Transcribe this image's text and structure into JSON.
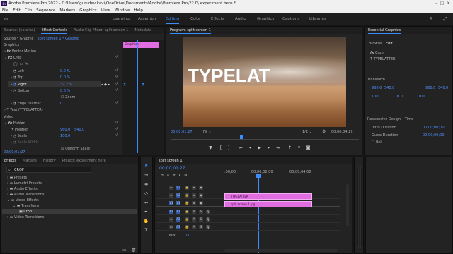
{
  "titlebar": {
    "text": "Adobe Premiere Pro 2022 - C:\\Users\\gurudev kavi\\OneDrive\\Documents\\Adobe\\Premiere Pro\\22.0\\ experiment here *"
  },
  "menu": [
    "File",
    "Edit",
    "Clip",
    "Sequence",
    "Markers",
    "Graphics",
    "View",
    "Window",
    "Help"
  ],
  "workspaces": [
    "Learning",
    "Assembly",
    "Editing",
    "Color",
    "Effects",
    "Audio",
    "Graphics",
    "Captions",
    "Libraries"
  ],
  "active_workspace": "Editing",
  "source_panel": {
    "tabs": [
      "Source: (no clips)",
      "Effect Controls",
      "Audio Clip Mixer: split screen 1",
      "Metadata"
    ],
    "active_tab": "Effect Controls",
    "header": "Source * Graphic",
    "sequence": "split screen 1 * Graphic",
    "clip_label": "Graphics",
    "sections": {
      "graphics": "Graphics",
      "video": "Video"
    },
    "effects": {
      "vector_motion": "Vector Motion",
      "crop": "Crop",
      "text": "Text (TYPELATTER)",
      "motion": "Motion"
    },
    "props": [
      {
        "name": "Left",
        "value": "0.0 %"
      },
      {
        "name": "Top",
        "value": "0.0 %"
      },
      {
        "name": "Right",
        "value": "32.7 %"
      },
      {
        "name": "Bottom",
        "value": "0.0 %"
      },
      {
        "name": "Zoom",
        "value": ""
      },
      {
        "name": "Edge Feather",
        "value": "0"
      }
    ],
    "motion_props": [
      {
        "name": "Position",
        "value": "960.0",
        "value2": "540.0"
      },
      {
        "name": "Scale",
        "value": "100.0"
      },
      {
        "name": "Scale Width",
        "value": ""
      }
    ],
    "uniform_scale": "Uniform Scale",
    "timecode": "00;00;01;27"
  },
  "program": {
    "tab": "Program: split screen 1",
    "overlay_text": "TYPELAT",
    "timecode": "00;00;01;27",
    "fit": "Fit",
    "resolution": "1/2",
    "duration": "00;00;04;29"
  },
  "essential_graphics": {
    "title": "Essential Graphics",
    "tabs": [
      "Browse",
      "Edit"
    ],
    "active_tab": "Edit",
    "layers": [
      "Crop",
      "TYPELATTER"
    ],
    "transform_label": "Transform",
    "transform_values": [
      "960.0",
      "540.0",
      "960.0",
      "540.0",
      "100",
      "0.0",
      "100"
    ],
    "responsive_label": "Responsive Design – Time",
    "intro_label": "Intro Duration",
    "intro_value": "00;00;00;00",
    "outro_label": "Outro Duration",
    "outro_value": "00;00;00;00",
    "roll_label": "Roll"
  },
  "project": {
    "tabs": [
      "Effects",
      "Markers",
      "History",
      "Project: experiment here"
    ],
    "active_tab": "Effects",
    "search": "CROP",
    "tree": [
      {
        "label": "Presets",
        "level": 0
      },
      {
        "label": "Lumetri Presets",
        "level": 0
      },
      {
        "label": "Audio Effects",
        "level": 0
      },
      {
        "label": "Audio Transitions",
        "level": 0
      },
      {
        "label": "Video Effects",
        "level": 0
      },
      {
        "label": "Transform",
        "level": 1
      },
      {
        "label": "Crop",
        "level": 2
      },
      {
        "label": "Video Transitions",
        "level": 0
      }
    ]
  },
  "timeline": {
    "tab": "split screen 1",
    "timecode": "00;00;01;27",
    "ruler": [
      ":00;00",
      "00;00;02;00",
      "00;00;04;00"
    ],
    "video_tracks": [
      "V3",
      "V2",
      "V1"
    ],
    "audio_tracks": [
      "A1",
      "A2",
      "A3"
    ],
    "mix_label": "Mix",
    "mix_value": "0.0",
    "clips": [
      {
        "label": "TYPELATTER",
        "track": "V2"
      },
      {
        "label": "split screen 1.jpg",
        "track": "V1"
      }
    ],
    "colors": {
      "clip": "#e06ee0",
      "playhead": "#3b8cff",
      "active_tab": "#3b8cff"
    }
  }
}
